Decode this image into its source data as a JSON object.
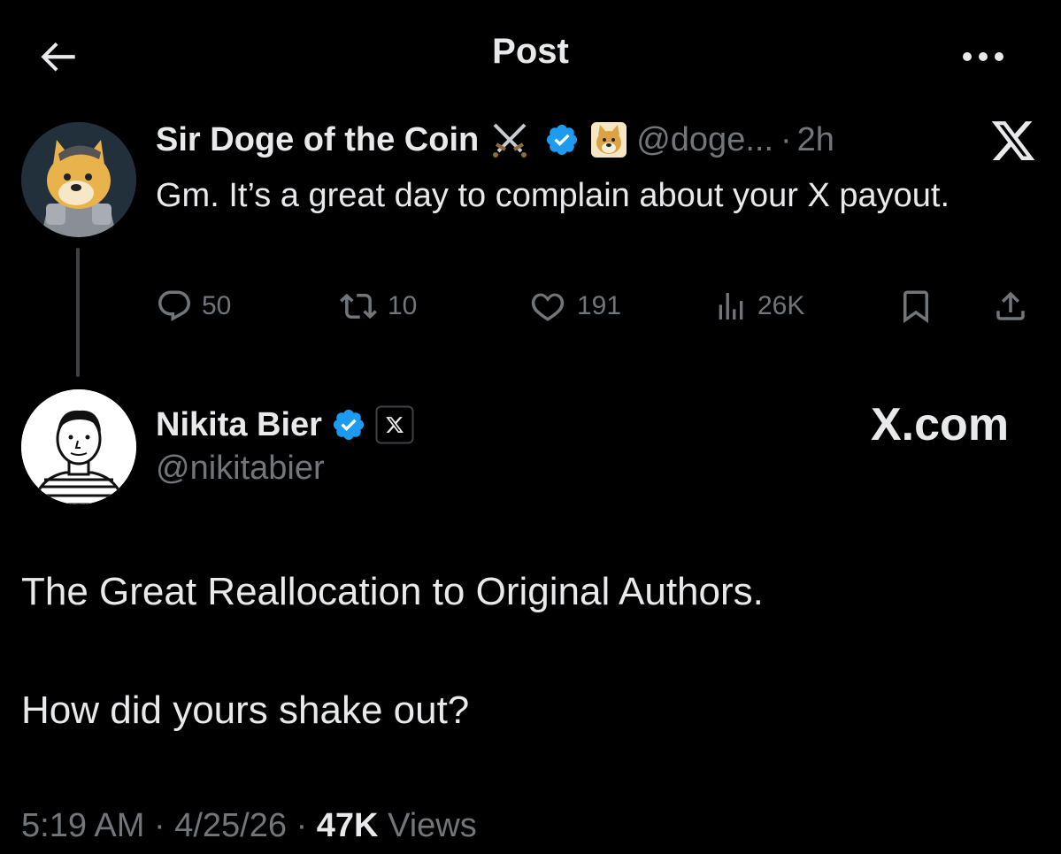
{
  "header": {
    "title": "Post",
    "back_icon": "arrow-left-icon",
    "more_icon": "more-horizontal-icon"
  },
  "parent_post": {
    "author_name": "Sir Doge of the Coin",
    "handle_truncated": "@doge...",
    "separator": "·",
    "time": "2h",
    "text": "Gm. It’s a great day to complain about your X payout.",
    "actions": {
      "replies": "50",
      "reposts": "10",
      "likes": "191",
      "views": "26K"
    },
    "badge_color": "#1d9bf0"
  },
  "main_post": {
    "author_name": "Nikita Bier",
    "handle": "@nikitabier",
    "affiliation_label": "X.com",
    "paragraph_1": "The Great Reallocation to Original Authors.",
    "paragraph_2": "How did yours shake out?",
    "meta": {
      "time": "5:19 AM",
      "sep1": "·",
      "date": "4/25/26",
      "sep2": "·",
      "views_count": "47K",
      "views_label": "Views"
    }
  },
  "colors": {
    "background": "#000000",
    "text": "#e7e9ea",
    "secondary": "#71767b",
    "verified": "#1d9bf0"
  }
}
